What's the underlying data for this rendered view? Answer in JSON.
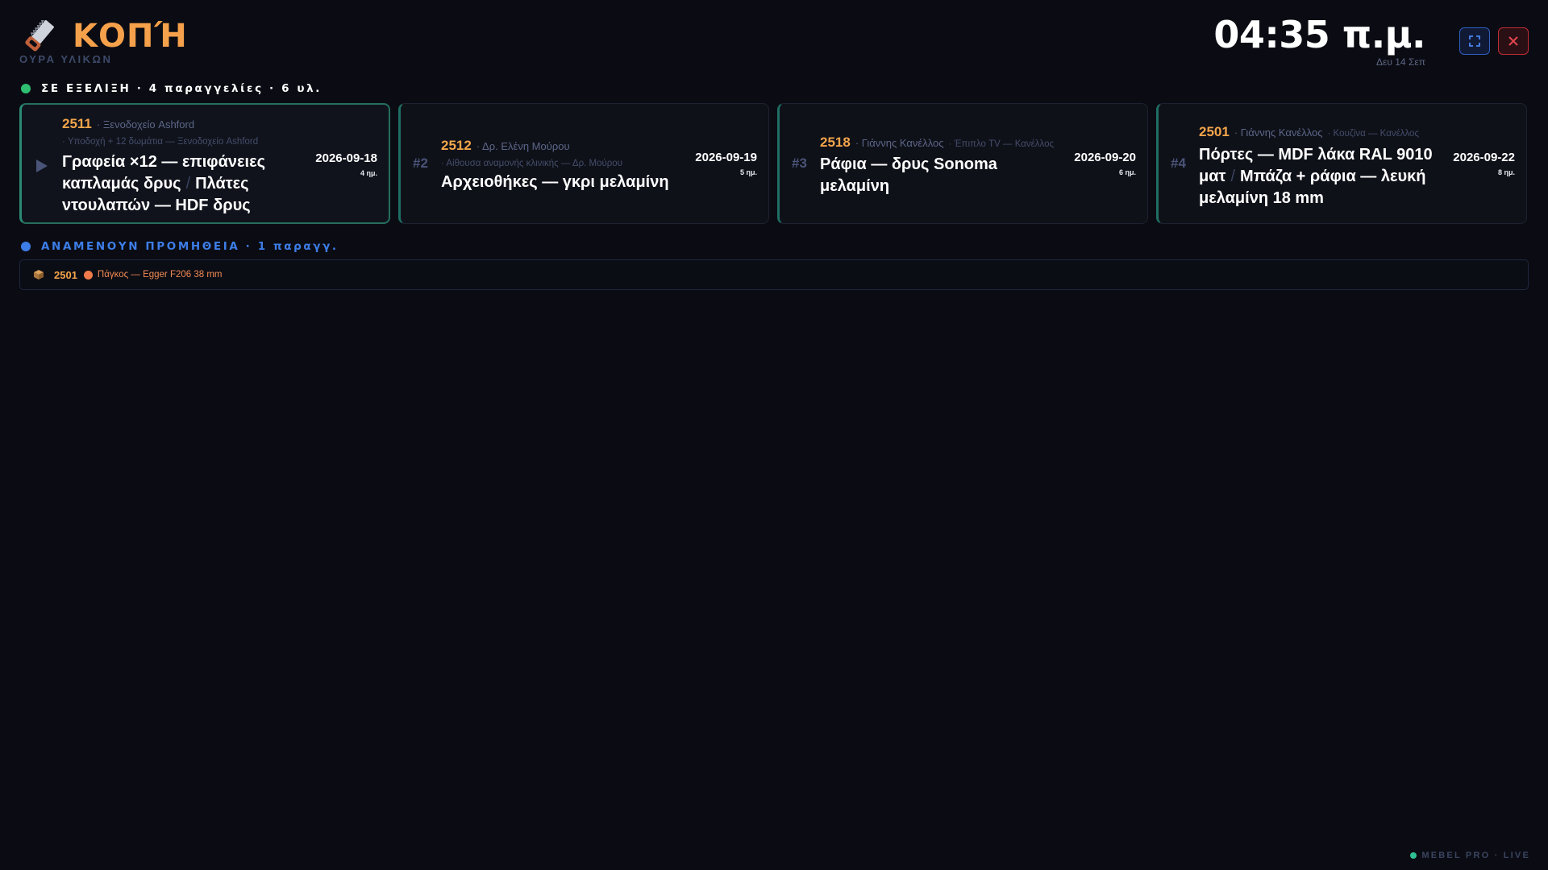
{
  "header": {
    "title": "ΚΟΠΉ",
    "subtitle": "ΟΥΡΑ ΥΛΙΚΩΝ",
    "icon": "saw-icon",
    "clock": "04:35 π.μ.",
    "date": "Δευ 14 Σεπ",
    "fullscreen_icon": "fullscreen-icon",
    "close_icon": "close-icon"
  },
  "in_progress": {
    "label": "ΣΕ ΕΞΕΛΙΞΗ · 4 παραγγελίες · 6 υλ.",
    "dot_color": "#2fbf71",
    "cards": [
      {
        "rank": "",
        "order_id": "2511",
        "client": "· Ξενοδοχείο Ashford",
        "sub": "· Υποδοχή + 12 δωμάτια — Ξενοδοχείο Ashford",
        "title_a": "Γραφεία ×12 — επιφάνειες καπλαμάς δρυς",
        "title_b": "Πλάτες ντουλαπών — HDF δρυς",
        "due": "2026-09-18",
        "days": "4 ημ."
      },
      {
        "rank": "#2",
        "order_id": "2512",
        "client": "· Δρ. Ελένη Μούρου",
        "sub": "· Αίθουσα αναμονής κλινικής — Δρ. Μούρου",
        "title_a": "Αρχειοθήκες — γκρι μελαμίνη",
        "title_b": "",
        "due": "2026-09-19",
        "days": "5 ημ."
      },
      {
        "rank": "#3",
        "order_id": "2518",
        "client": "· Γιάννης Κανέλλος",
        "sub": "· Έπιπλο TV — Κανέλλος",
        "title_a": "Ράφια — δρυς Sonoma μελαμίνη",
        "title_b": "",
        "due": "2026-09-20",
        "days": "6 ημ."
      },
      {
        "rank": "#4",
        "order_id": "2501",
        "client": "· Γιάννης Κανέλλος",
        "sub": "· Κουζίνα — Κανέλλος",
        "title_a": "Πόρτες — MDF λάκα RAL 9010 ματ",
        "title_b": "Μπάζα + ράφια — λευκή μελαμίνη 18 mm",
        "due": "2026-09-22",
        "days": "8 ημ."
      }
    ]
  },
  "waiting": {
    "label": "ΑΝΑΜΕΝΟΥΝ ΠΡΟΜΗΘΕΙΑ · 1 παραγγ.",
    "dot_color": "#3d7de8",
    "items": [
      {
        "icon": "package-icon",
        "order_id": "2501",
        "text": "Πάγκος — Egger F206 38 mm"
      }
    ]
  },
  "footer": {
    "label": "MEBEL PRO · LIVE"
  },
  "colors": {
    "accent": "#f5a04a",
    "bg": "#0b0c13",
    "teal": "#2a8a73"
  }
}
